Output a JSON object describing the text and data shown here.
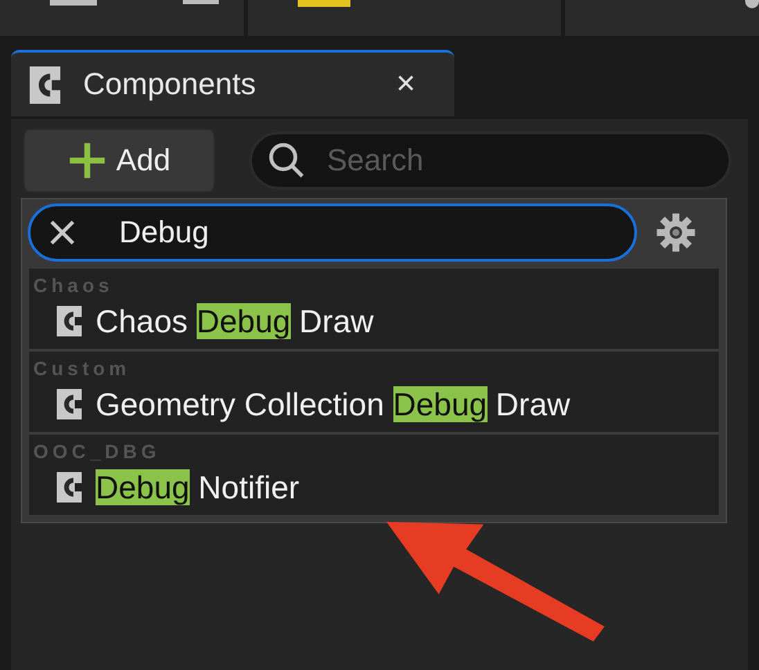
{
  "tab": {
    "title": "Components",
    "close": "×"
  },
  "add_button": {
    "label": "Add"
  },
  "search": {
    "placeholder": "Search"
  },
  "dropdown": {
    "query": "Debug",
    "focused": true,
    "groups": [
      {
        "category": "Chaos",
        "items": [
          {
            "parts": [
              {
                "text": "Chaos ",
                "highlight": false
              },
              {
                "text": "Debug",
                "highlight": true
              },
              {
                "text": " Draw",
                "highlight": false
              }
            ]
          }
        ]
      },
      {
        "category": "Custom",
        "items": [
          {
            "parts": [
              {
                "text": "Geometry Collection ",
                "highlight": false
              },
              {
                "text": "Debug",
                "highlight": true
              },
              {
                "text": " Draw",
                "highlight": false
              }
            ]
          }
        ]
      },
      {
        "category": "OOC_DBG",
        "items": [
          {
            "parts": [
              {
                "text": "Debug",
                "highlight": true
              },
              {
                "text": " Notifier",
                "highlight": false
              }
            ]
          }
        ]
      }
    ]
  }
}
